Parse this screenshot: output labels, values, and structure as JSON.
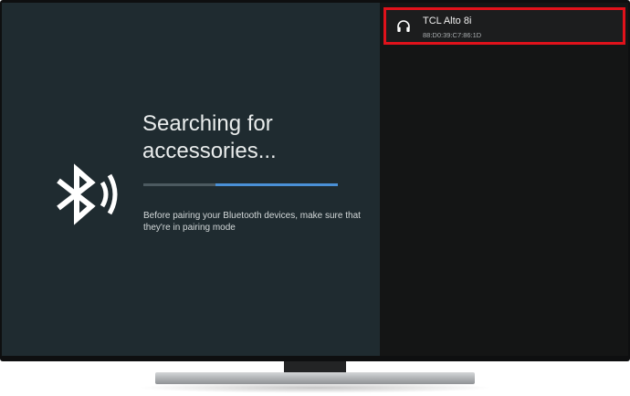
{
  "pairing": {
    "title": "Searching for accessories...",
    "hint": "Before pairing your Bluetooth devices, make sure that they're in pairing mode",
    "progress": 0.63
  },
  "devices": [
    {
      "name": "TCL Alto 8i",
      "mac": "88:D0:39:C7:86:1D",
      "icon": "headphones-icon"
    }
  ],
  "colors": {
    "left_panel": "#1f2b30",
    "right_panel": "#141515",
    "progress_accent": "#4a90d6",
    "highlight_border": "#e0121b"
  }
}
